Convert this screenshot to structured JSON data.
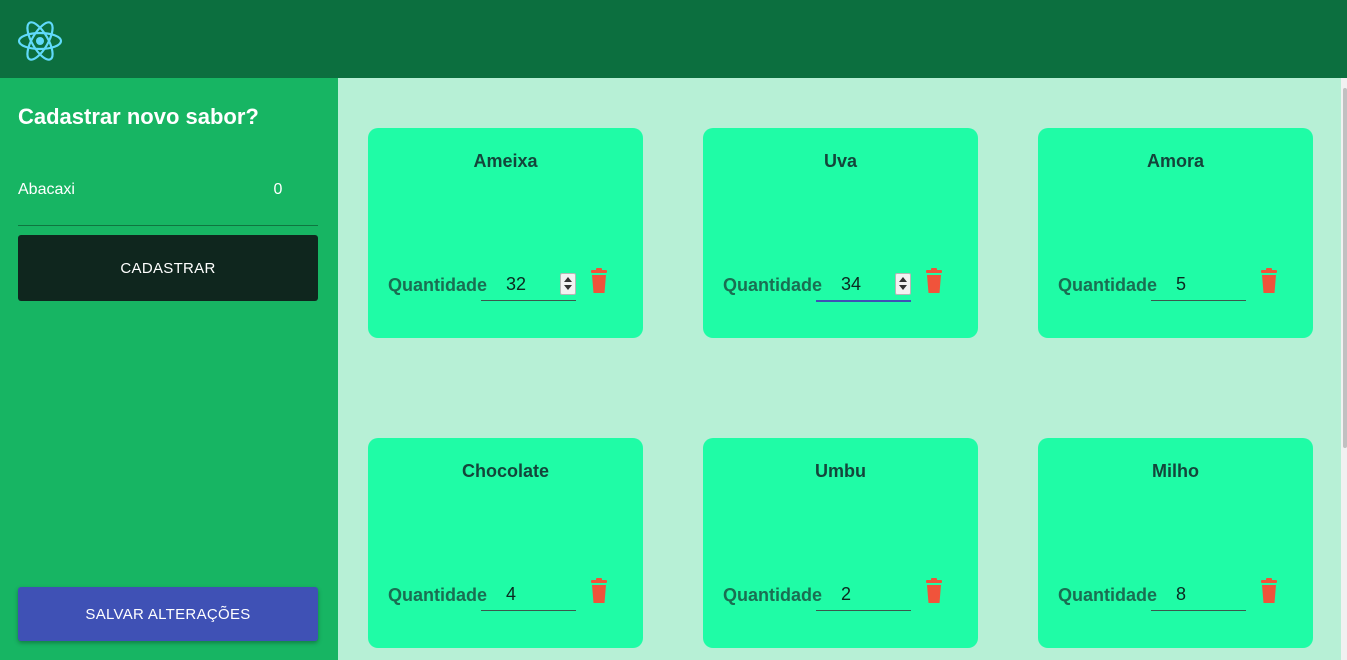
{
  "colors": {
    "header": "#0c6f3f",
    "sidebar": "#17b563",
    "main_bg": "#b7f0d6",
    "card": "#1ffca6",
    "delete": "#f0533b",
    "primary_button": "#3f51b5",
    "dark_button": "#0f261e"
  },
  "header": {
    "logo_icon": "react-atom-icon"
  },
  "sidebar": {
    "title": "Cadastrar novo sabor?",
    "flavor_value": "Abacaxi",
    "quantity_value": "0",
    "register_button": "CADASTRAR",
    "save_button": "SALVAR ALTERAÇÕES"
  },
  "cards": [
    {
      "name": "Ameixa",
      "quantity_label": "Quantidade",
      "quantity": "32"
    },
    {
      "name": "Uva",
      "quantity_label": "Quantidade",
      "quantity": "34"
    },
    {
      "name": "Amora",
      "quantity_label": "Quantidade",
      "quantity": "5"
    },
    {
      "name": "Chocolate",
      "quantity_label": "Quantidade",
      "quantity": "4"
    },
    {
      "name": "Umbu",
      "quantity_label": "Quantidade",
      "quantity": "2"
    },
    {
      "name": "Milho",
      "quantity_label": "Quantidade",
      "quantity": "8"
    }
  ]
}
